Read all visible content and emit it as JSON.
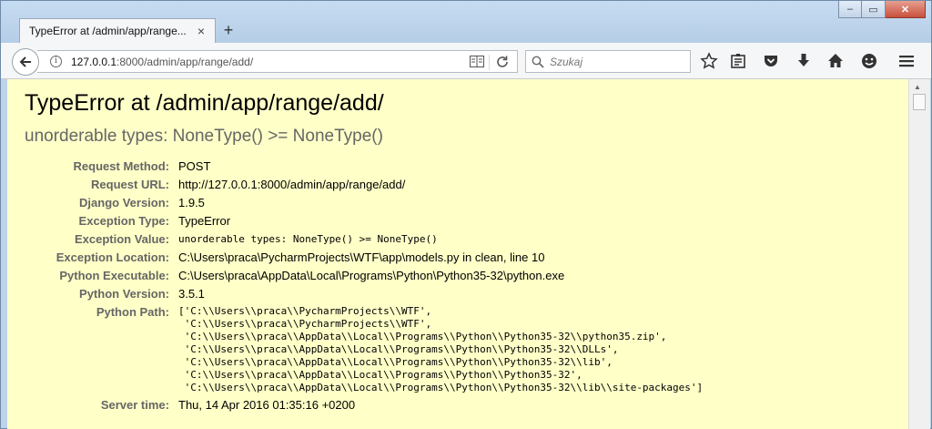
{
  "window": {
    "tab_title": "TypeError at /admin/app/range...",
    "tab_close": "×",
    "new_tab": "+",
    "minimize": "‒",
    "maximize": "▭",
    "close": "✕"
  },
  "navbar": {
    "url_host": "127.0.0.1",
    "url_rest": ":8000/admin/app/range/add/",
    "search_placeholder": "Szukaj",
    "icons": [
      "back-arrow-icon",
      "info-icon",
      "reader-view-icon",
      "reload-icon",
      "search-icon",
      "star-icon",
      "reading-list-icon",
      "pocket-icon",
      "download-icon",
      "home-icon",
      "smiley-icon",
      "menu-icon"
    ]
  },
  "page": {
    "title": "TypeError at /admin/app/range/add/",
    "subtitle": "unorderable types: NoneType() >= NoneType()",
    "meta": [
      {
        "label": "Request Method:",
        "value": "POST"
      },
      {
        "label": "Request URL:",
        "value": "http://127.0.0.1:8000/admin/app/range/add/"
      },
      {
        "label": "Django Version:",
        "value": "1.9.5"
      },
      {
        "label": "Exception Type:",
        "value": "TypeError"
      },
      {
        "label": "Exception Value:",
        "value": "unorderable types: NoneType() >= NoneType()"
      },
      {
        "label": "Exception Location:",
        "value": "C:\\Users\\praca\\PycharmProjects\\WTF\\app\\models.py in clean, line 10"
      },
      {
        "label": "Python Executable:",
        "value": "C:\\Users\\praca\\AppData\\Local\\Programs\\Python\\Python35-32\\python.exe"
      },
      {
        "label": "Python Version:",
        "value": "3.5.1"
      },
      {
        "label": "Python Path:",
        "value": "['C:\\\\Users\\\\praca\\\\PycharmProjects\\\\WTF',\n 'C:\\\\Users\\\\praca\\\\PycharmProjects\\\\WTF',\n 'C:\\\\Users\\\\praca\\\\AppData\\\\Local\\\\Programs\\\\Python\\\\Python35-32\\\\python35.zip',\n 'C:\\\\Users\\\\praca\\\\AppData\\\\Local\\\\Programs\\\\Python\\\\Python35-32\\\\DLLs',\n 'C:\\\\Users\\\\praca\\\\AppData\\\\Local\\\\Programs\\\\Python\\\\Python35-32\\\\lib',\n 'C:\\\\Users\\\\praca\\\\AppData\\\\Local\\\\Programs\\\\Python\\\\Python35-32',\n 'C:\\\\Users\\\\praca\\\\AppData\\\\Local\\\\Programs\\\\Python\\\\Python35-32\\\\lib\\\\site-packages']"
      },
      {
        "label": "Server time:",
        "value": "Thu, 14 Apr 2016 01:35:16 +0200"
      }
    ]
  },
  "colors": {
    "page_background": "#ffffc8",
    "label_color": "#666666",
    "subtitle_color": "#666666"
  }
}
